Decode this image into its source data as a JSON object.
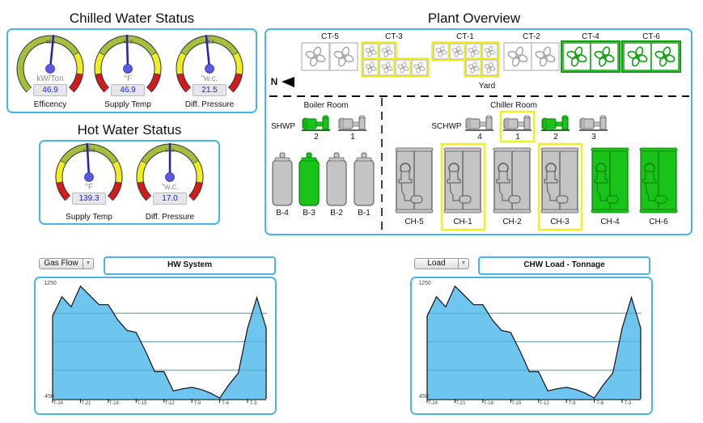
{
  "chilled_water": {
    "title": "Chilled Water Status",
    "gauges": [
      {
        "label": "Efficency",
        "unit": "kW/Ton",
        "value": "46.9",
        "scale_mark": "46.0",
        "needle": 46.9,
        "zones": "olive-yellow-red"
      },
      {
        "label": "Supply Temp",
        "unit": "°F",
        "value": "46.9",
        "scale_mark": "46.0",
        "needle": 46.9,
        "zones": "red-yellow-olive-yellow-red"
      },
      {
        "label": "Diff. Pressure",
        "unit": "\"w.c.",
        "value": "21.5",
        "scale_mark": "21.0",
        "needle": 21.5,
        "zones": "red-yellow-olive-yellow-red"
      }
    ]
  },
  "hot_water": {
    "title": "Hot Water Status",
    "gauges": [
      {
        "label": "Supply Temp",
        "unit": "°F",
        "value": "139.3",
        "scale_mark": "139.0",
        "needle": 139.3,
        "zones": "red-yellow-olive-yellow-red"
      },
      {
        "label": "Diff. Pressure",
        "unit": "\"w.c.",
        "value": "17.0",
        "scale_mark": "17.0",
        "needle": 17.0,
        "zones": "red-yellow-olive-yellow-red"
      }
    ]
  },
  "plant": {
    "title": "Plant Overview",
    "north_label": "N",
    "yard_label": "Yard",
    "cooling_towers": [
      {
        "name": "CT-5",
        "status": "off",
        "selected": false
      },
      {
        "name": "CT-3",
        "status": "off",
        "selected": true
      },
      {
        "name": "CT-1",
        "status": "off",
        "selected": true
      },
      {
        "name": "CT-2",
        "status": "off",
        "selected": false
      },
      {
        "name": "CT-4",
        "status": "on",
        "selected": false
      },
      {
        "name": "CT-6",
        "status": "on",
        "selected": false
      }
    ],
    "boiler_room": {
      "label": "Boiler Room",
      "pump_group": "SHWP",
      "pumps": [
        {
          "name": "2",
          "status": "on"
        },
        {
          "name": "1",
          "status": "off"
        }
      ],
      "boilers": [
        {
          "name": "B-4",
          "status": "off"
        },
        {
          "name": "B-3",
          "status": "on"
        },
        {
          "name": "B-2",
          "status": "off"
        },
        {
          "name": "B-1",
          "status": "off"
        }
      ]
    },
    "chiller_room": {
      "label": "Chiller Room",
      "pump_group": "SCHWP",
      "pumps": [
        {
          "name": "4",
          "status": "off",
          "selected": false
        },
        {
          "name": "1",
          "status": "off",
          "selected": true
        },
        {
          "name": "2",
          "status": "on",
          "selected": false
        },
        {
          "name": "3",
          "status": "off",
          "selected": false
        }
      ],
      "chillers": [
        {
          "name": "CH-5",
          "status": "off",
          "selected": false
        },
        {
          "name": "CH-1",
          "status": "off",
          "selected": true
        },
        {
          "name": "CH-2",
          "status": "off",
          "selected": false
        },
        {
          "name": "CH-3",
          "status": "off",
          "selected": true
        },
        {
          "name": "CH-4",
          "status": "on",
          "selected": false
        },
        {
          "name": "CH-6",
          "status": "on",
          "selected": false
        }
      ]
    }
  },
  "colors": {
    "on": "#19c319",
    "off": "#c8c8cc",
    "selected": "#f0f020",
    "accent": "#49b5e6",
    "area": "#66c2ec",
    "needle": "#2222aa"
  },
  "hw_chart": {
    "dropdown": "Gas Flow",
    "title": "HW System"
  },
  "chw_chart": {
    "dropdown": "Load",
    "title": "CHW Load - Tonnage"
  },
  "chart_data": [
    {
      "type": "area",
      "title": "HW System",
      "ylim": [
        450,
        1250
      ],
      "ytick_labels": [
        "1250",
        "450"
      ],
      "gridlines": [
        650,
        850,
        1050
      ],
      "xtick_labels": [
        "T-24",
        "T-21",
        "T-18",
        "T-15",
        "T-12",
        "T-9",
        "T-6",
        "T-3"
      ],
      "x": [
        "T-24",
        "T-23",
        "T-22",
        "T-21",
        "T-20",
        "T-19",
        "T-18",
        "T-17",
        "T-16",
        "T-15",
        "T-14",
        "T-13",
        "T-12",
        "T-11",
        "T-10",
        "T-9",
        "T-8",
        "T-7",
        "T-6",
        "T-5",
        "T-4",
        "T-3",
        "T-2",
        "T-1"
      ],
      "values": [
        1030,
        1165,
        1095,
        1240,
        1175,
        1110,
        1110,
        1005,
        930,
        915,
        785,
        640,
        640,
        505,
        520,
        530,
        515,
        490,
        455,
        550,
        630,
        945,
        1160,
        945
      ]
    },
    {
      "type": "area",
      "title": "CHW Load - Tonnage",
      "ylim": [
        450,
        1250
      ],
      "ytick_labels": [
        "1250",
        "450"
      ],
      "gridlines": [
        650,
        850,
        1050
      ],
      "xtick_labels": [
        "T-24",
        "T-21",
        "T-18",
        "T-15",
        "T-12",
        "T-9",
        "T-6",
        "T-3"
      ],
      "x": [
        "T-24",
        "T-23",
        "T-22",
        "T-21",
        "T-20",
        "T-19",
        "T-18",
        "T-17",
        "T-16",
        "T-15",
        "T-14",
        "T-13",
        "T-12",
        "T-11",
        "T-10",
        "T-9",
        "T-8",
        "T-7",
        "T-6",
        "T-5",
        "T-4",
        "T-3",
        "T-2",
        "T-1"
      ],
      "values": [
        1030,
        1165,
        1095,
        1240,
        1175,
        1110,
        1110,
        1005,
        930,
        915,
        785,
        640,
        640,
        505,
        520,
        530,
        515,
        490,
        455,
        550,
        630,
        945,
        1160,
        945
      ]
    }
  ]
}
